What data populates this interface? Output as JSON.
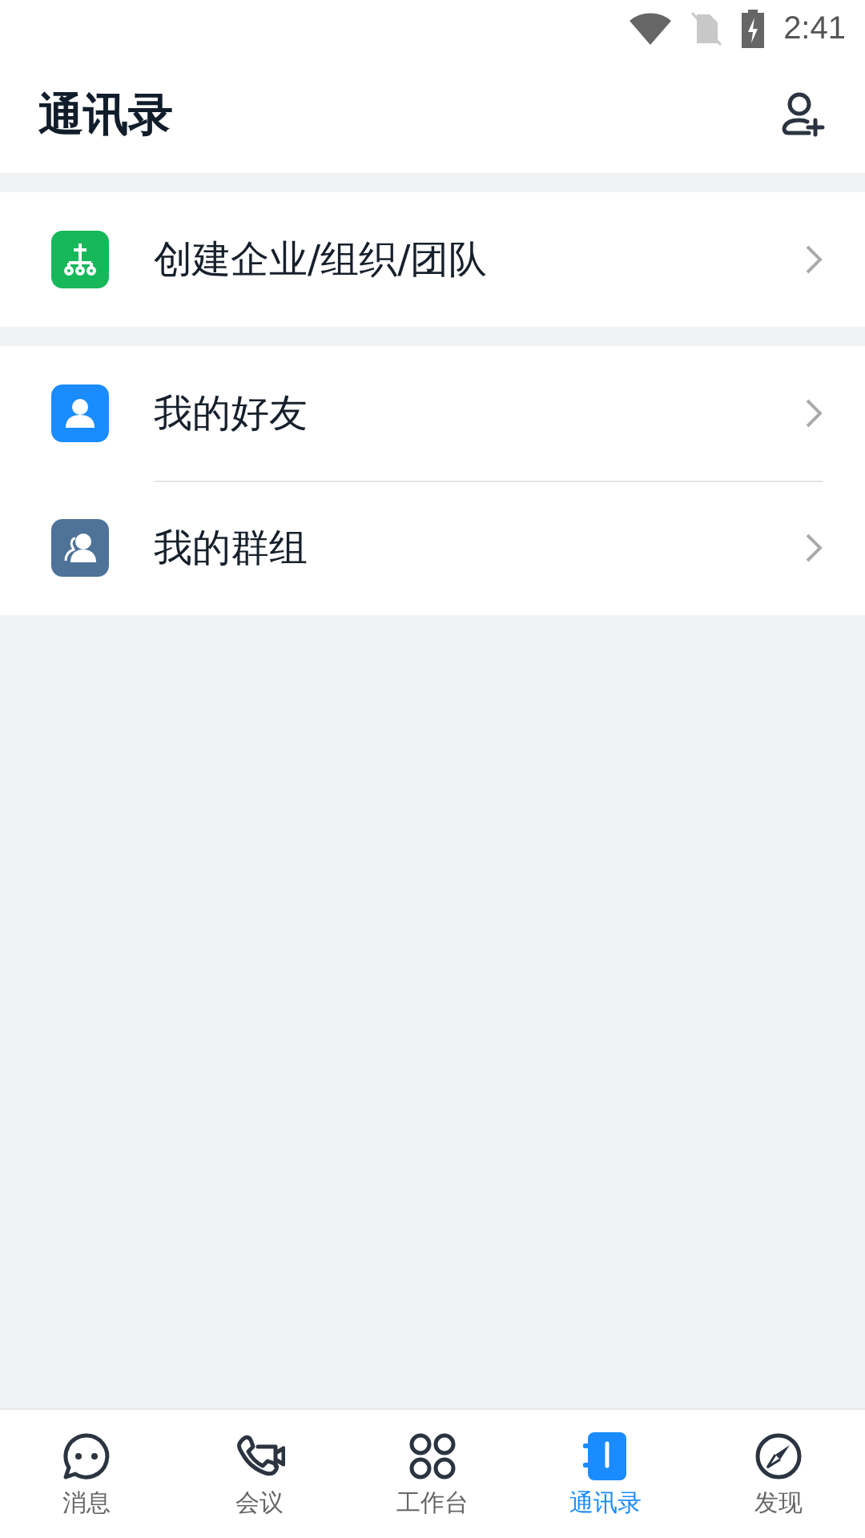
{
  "status_bar": {
    "time": "2:41"
  },
  "header": {
    "title": "通讯录"
  },
  "sections": [
    {
      "items": [
        {
          "label": "创建企业/组织/团队",
          "kind": "org",
          "color": "#17b85a"
        }
      ]
    },
    {
      "items": [
        {
          "label": "我的好友",
          "kind": "friend",
          "color": "#1a8cff"
        },
        {
          "label": "我的群组",
          "kind": "group",
          "color": "#4f7299"
        }
      ]
    }
  ],
  "tabs": [
    {
      "label": "消息",
      "kind": "chat",
      "selected": false
    },
    {
      "label": "会议",
      "kind": "meeting",
      "selected": false
    },
    {
      "label": "工作台",
      "kind": "apps",
      "selected": false
    },
    {
      "label": "通讯录",
      "kind": "contacts",
      "selected": true
    },
    {
      "label": "发现",
      "kind": "discover",
      "selected": false
    }
  ]
}
